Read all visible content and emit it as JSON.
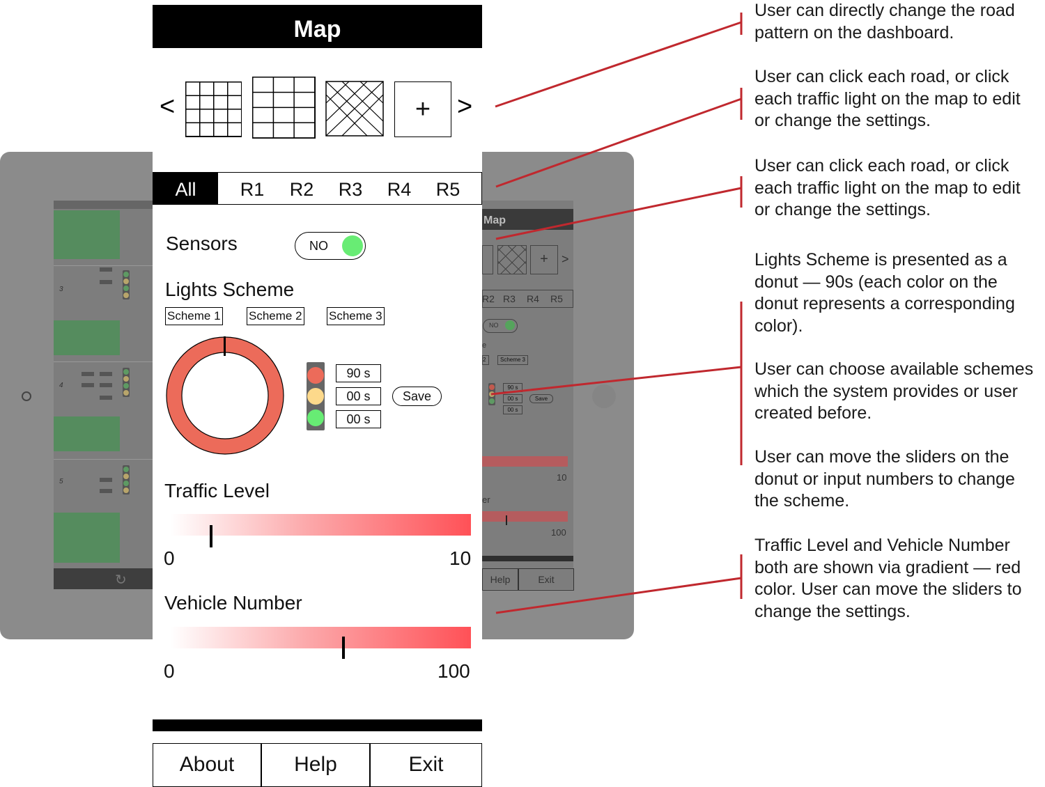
{
  "header": {
    "title": "Map"
  },
  "patterns": {
    "prev_label": "<",
    "next_label": ">",
    "add_label": "+",
    "items": [
      "grid-4x4-icon",
      "grid-3x4-icon",
      "diagonal-grid-icon",
      "add-pattern-icon"
    ]
  },
  "road_tabs": [
    "All",
    "R1",
    "R2",
    "R3",
    "R4",
    "R5"
  ],
  "sensors": {
    "label": "Sensors",
    "toggle_text": "NO"
  },
  "lights_scheme": {
    "label": "Lights Scheme",
    "schemes": [
      "Scheme 1",
      "Scheme 2",
      "Scheme 3"
    ],
    "times": [
      "90 s",
      "00 s",
      "00 s"
    ],
    "save_label": "Save",
    "colors": {
      "red": "#ec6b5a",
      "yellow": "#fdd98b",
      "green": "#67ec74"
    }
  },
  "traffic_level": {
    "label": "Traffic Level",
    "min": "0",
    "max": "10",
    "value": 1.3
  },
  "vehicle_number": {
    "label": "Vehicle Number",
    "min": "0",
    "max": "100",
    "value": 57
  },
  "footer": {
    "buttons": [
      "About",
      "Help",
      "Exit"
    ]
  },
  "background_mockup": {
    "title": "Map",
    "tabs": [
      "R2",
      "R3",
      "R4",
      "R5"
    ],
    "toggle_text": "NO",
    "scheme_label": "Scheme 3",
    "times": [
      "90 s",
      "00 s",
      "00 s"
    ],
    "save_label": "Save",
    "level_max": "10",
    "vehicle_max": "100",
    "vehicle_partial": "er",
    "footer": [
      "Help",
      "Exit"
    ],
    "row_numbers": [
      "3",
      "4",
      "5"
    ],
    "partial_label": "e",
    "partial_scheme": "2"
  },
  "annotations": [
    "User can directly change the road pattern on the dashboard.",
    "User can click each road, or click each traffic light on the map to edit or change the settings.",
    "User can click each road, or click each traffic light on the map to edit or change the settings.",
    "Lights Scheme is presented as a donut — 90s (each color on the donut represents a corresponding color).",
    "User can choose available schemes which the system provides or user created before.",
    "User can move the sliders on the donut or input numbers to change the scheme.",
    "Traffic Level and Vehicle Number both are shown via gradient — red color. User can move the sliders to change the settings."
  ],
  "annotation_color": "#c0282e"
}
